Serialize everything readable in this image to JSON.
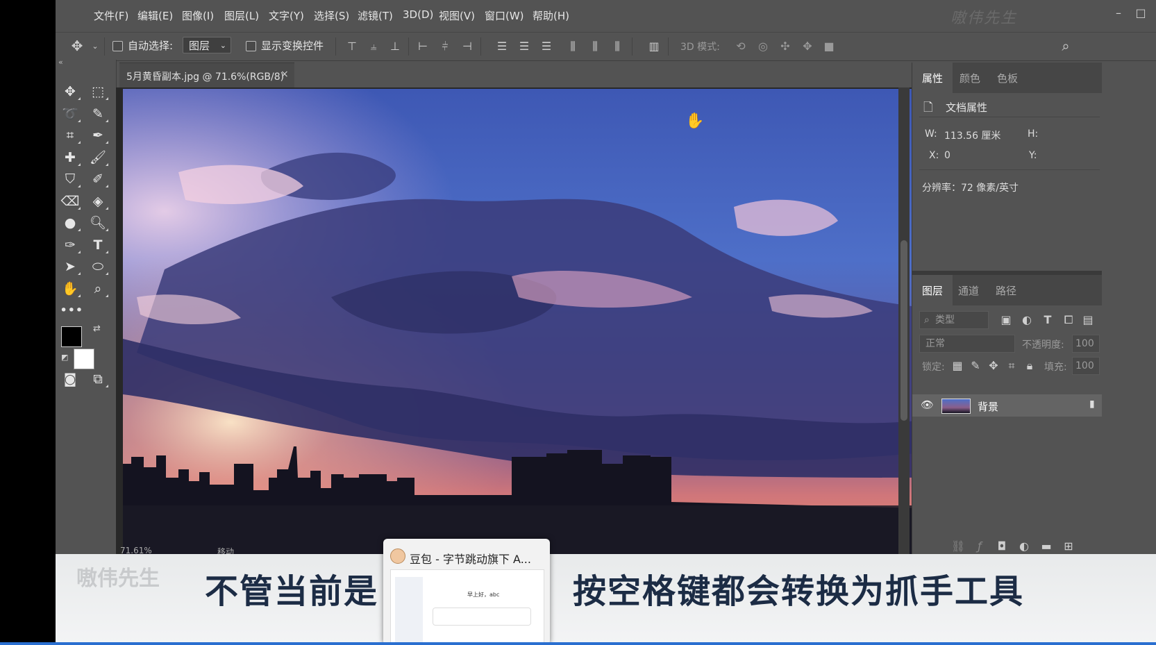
{
  "window": {
    "watermark": "嗷伟先生",
    "minimize": "–",
    "maximize": "□"
  },
  "menu": [
    "文件(F)",
    "编辑(E)",
    "图像(I)",
    "图层(L)",
    "文字(Y)",
    "选择(S)",
    "滤镜(T)",
    "3D(D)",
    "视图(V)",
    "窗口(W)",
    "帮助(H)"
  ],
  "options": {
    "move_icon": "move-icon",
    "auto_select_label": "自动选择:",
    "auto_select_value": "图层",
    "show_transform_label": "显示变换控件",
    "mode3d_label": "3D 模式:"
  },
  "document": {
    "tab_title": "5月黄昏副本.jpg @ 71.6%(RGB/8)",
    "close": "×",
    "status_zoom": "71.61%",
    "status_text": "移动"
  },
  "colors": {
    "foreground": "#000000",
    "background": "#ffffff",
    "ui_bg": "#535353",
    "canvas_bg": "#282828",
    "caption_text": "#1c2c45"
  },
  "properties_panel": {
    "tabs": [
      "属性",
      "颜色",
      "色板"
    ],
    "active_tab": "属性",
    "section_title": "文档属性",
    "w_label": "W:",
    "w_value": "113.56 厘米",
    "h_label": "H:",
    "x_label": "X:",
    "x_value": "0",
    "y_label": "Y:",
    "resolution": "分辨率：72 像素/英寸"
  },
  "layers_panel": {
    "tabs": [
      "图层",
      "通道",
      "路径"
    ],
    "active_tab": "图层",
    "filter_placeholder": "类型",
    "blend_mode": "正常",
    "opacity_label": "不透明度:",
    "opacity_value": "100",
    "lock_label": "锁定:",
    "fill_label": "填充:",
    "fill_value": "100",
    "layers": [
      {
        "name": "背景",
        "visible": true
      }
    ]
  },
  "caption": {
    "watermark": "嗷伟先生",
    "left": "不管当前是",
    "right": "按空格键都会转换为抓手工具"
  },
  "popup": {
    "title": "豆包 - 字节跳动旗下 A...",
    "thumb_text": "早上好，abc"
  }
}
